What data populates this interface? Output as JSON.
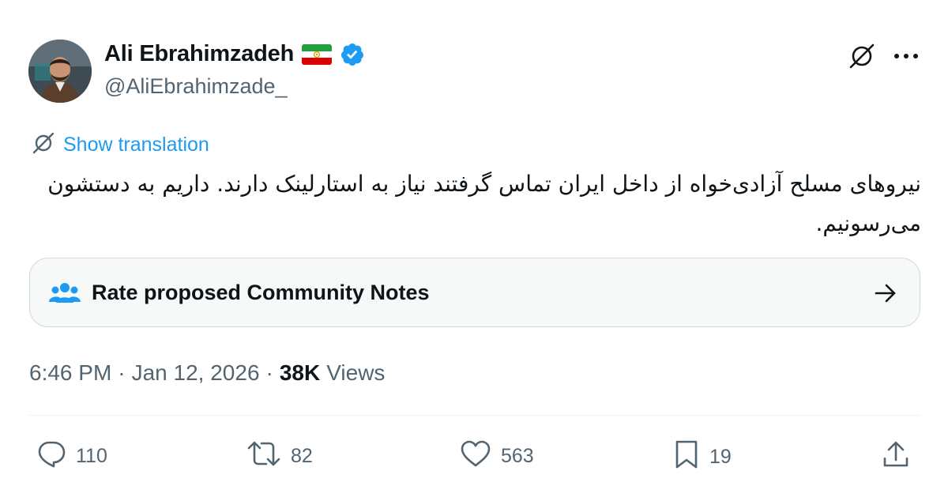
{
  "author": {
    "name": "Ali Ebrahimzadeh",
    "handle": "@AliEbrahimzade_",
    "verified": true,
    "flag_icon": "iran-flag-icon",
    "verified_icon": "verified-badge-icon"
  },
  "header_actions": {
    "grok_icon": "grok-icon",
    "more_icon": "more-icon"
  },
  "translation": {
    "label": "Show translation",
    "icon": "translate-icon"
  },
  "tweet": {
    "text": "نیروهای مسلح آزادی‌خواه از داخل ایران تماس گرفتند نیاز به استارلینک دارند. داریم به دستشون می‌رسونیم."
  },
  "community_notes": {
    "label": "Rate proposed Community Notes",
    "icon": "people-icon",
    "arrow_icon": "arrow-right-icon"
  },
  "meta": {
    "time": "6:46 PM",
    "separator": "·",
    "date": "Jan 12, 2026",
    "views_count": "38K",
    "views_label": "Views"
  },
  "actions": {
    "replies": "110",
    "reposts": "82",
    "likes": "563",
    "bookmarks": "19"
  },
  "colors": {
    "link": "#1d9bf0",
    "secondary_text": "#536471",
    "primary_text": "#0f1419",
    "border": "#cfd9de"
  }
}
